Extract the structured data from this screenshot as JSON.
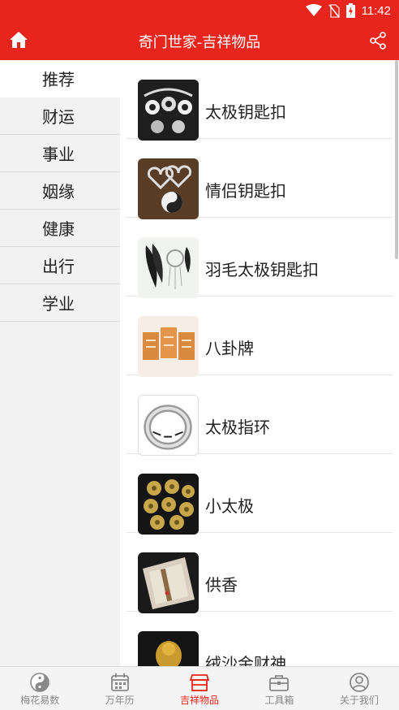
{
  "status_bar": {
    "time": "11:42",
    "icons": [
      "wifi-icon",
      "no-sim-icon",
      "battery-charging-icon"
    ]
  },
  "header": {
    "title": "奇门世家-吉祥物品",
    "left_icon": "home-icon",
    "right_icon": "share-icon"
  },
  "sidebar": {
    "items": [
      {
        "label": "推荐",
        "active": true
      },
      {
        "label": "财运"
      },
      {
        "label": "事业"
      },
      {
        "label": "姻缘"
      },
      {
        "label": "健康"
      },
      {
        "label": "出行"
      },
      {
        "label": "学业"
      }
    ]
  },
  "products": [
    {
      "name": "太极钥匙扣",
      "thumb": "taiji-keychain"
    },
    {
      "name": "情侣钥匙扣",
      "thumb": "couple-heart-keychain"
    },
    {
      "name": "羽毛太极钥匙扣",
      "thumb": "feather-taiji-keychain"
    },
    {
      "name": "八卦牌",
      "thumb": "bagua-plaques"
    },
    {
      "name": "太极指环",
      "thumb": "taiji-ring"
    },
    {
      "name": "小太极",
      "thumb": "small-taiji-coins"
    },
    {
      "name": "供香",
      "thumb": "incense-box"
    },
    {
      "name": "绒沙金财神",
      "thumb": "gold-wealth-god"
    }
  ],
  "bottom_nav": {
    "items": [
      {
        "label": "梅花易数",
        "icon": "taiji-icon"
      },
      {
        "label": "万年历",
        "icon": "calendar-icon"
      },
      {
        "label": "吉祥物品",
        "icon": "shop-icon",
        "active": true
      },
      {
        "label": "工具箱",
        "icon": "toolbox-icon"
      },
      {
        "label": "关于我们",
        "icon": "user-icon"
      }
    ]
  },
  "colors": {
    "brand": "#e8251c",
    "sidebar_bg": "#f2f2f2",
    "nav_bg": "#f4f4f4",
    "nav_inactive": "#888888"
  }
}
